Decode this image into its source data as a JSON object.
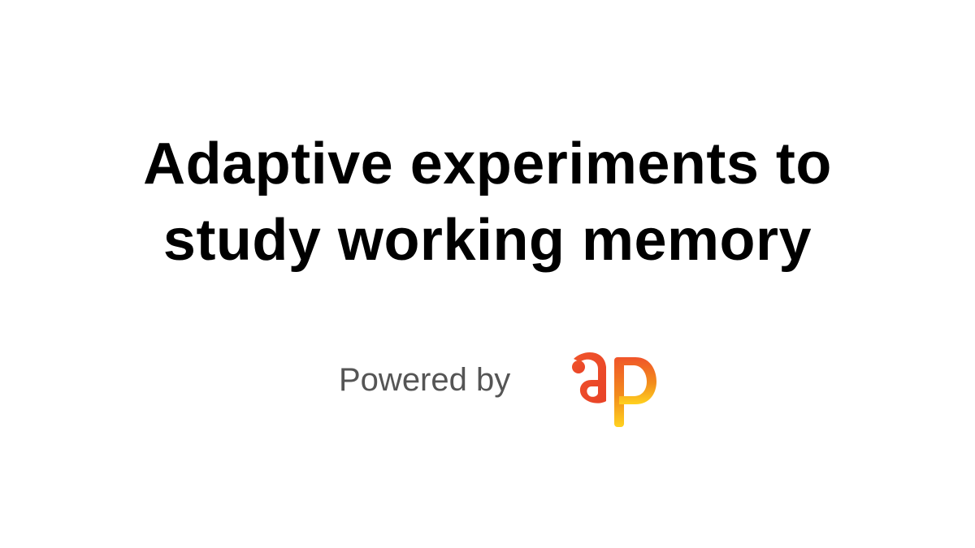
{
  "slide": {
    "title_line_1": "Adaptive experiments to",
    "title_line_2": "study working memory",
    "powered_by": "Powered by"
  },
  "logo": {
    "icon": "brand-logo-icon",
    "lettering": "ap",
    "colors": {
      "primary": "#f0542a",
      "secondary": "#f28c1c",
      "accent": "#ffd21f"
    }
  }
}
